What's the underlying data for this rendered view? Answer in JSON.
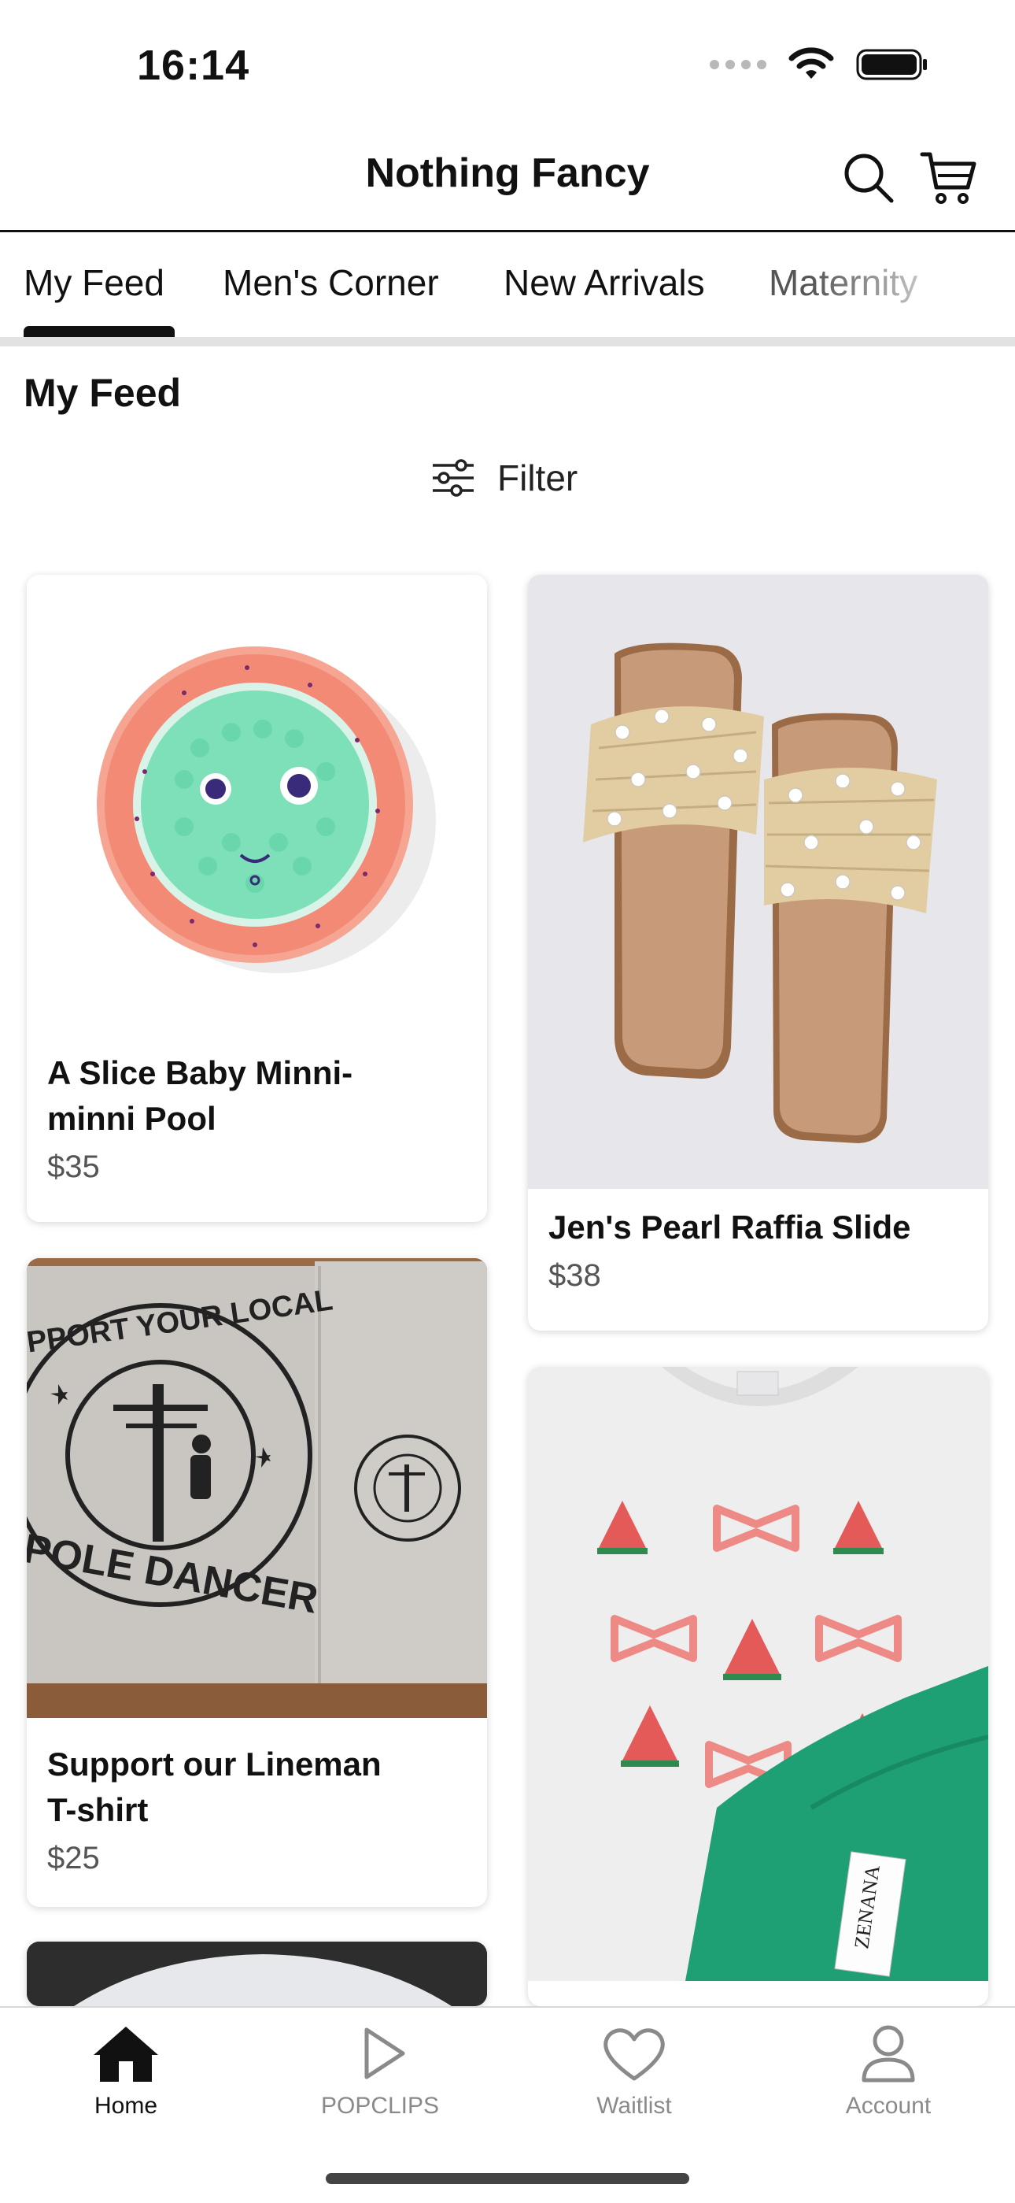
{
  "status_bar": {
    "time": "16:14"
  },
  "header": {
    "title": "Nothing Fancy",
    "search_icon": "search-icon",
    "cart_icon": "cart-icon"
  },
  "tabs": [
    {
      "label": "My Feed",
      "active": true
    },
    {
      "label": "Men's Corner",
      "active": false
    },
    {
      "label": "New Arrivals",
      "active": false
    },
    {
      "label": "Maternity",
      "active": false
    }
  ],
  "section": {
    "title": "My Feed",
    "filter_label": "Filter"
  },
  "products": [
    {
      "title_line1": "A Slice Baby Minni-",
      "title_line2": "minni Pool",
      "price": "$35"
    },
    {
      "title_line1": "Jen's Pearl Raffia Slide",
      "title_line2": "",
      "price": "$38"
    },
    {
      "title_line1": "Support our Lineman",
      "title_line2": "T-shirt",
      "price": "$25"
    },
    {
      "title_line1": "",
      "title_line2": "",
      "price": ""
    }
  ],
  "product_images": {
    "shirt_print_top": "SUPPORT YOUR LOCAL",
    "shirt_print_bottom": "POLE DANCER",
    "tag_brand": "ZENANA"
  },
  "bottom_nav": [
    {
      "label": "Home",
      "icon": "home-icon",
      "active": true
    },
    {
      "label": "POPCLIPS",
      "icon": "play-icon",
      "active": false
    },
    {
      "label": "Waitlist",
      "icon": "heart-icon",
      "active": false
    },
    {
      "label": "Account",
      "icon": "person-icon",
      "active": false
    }
  ]
}
